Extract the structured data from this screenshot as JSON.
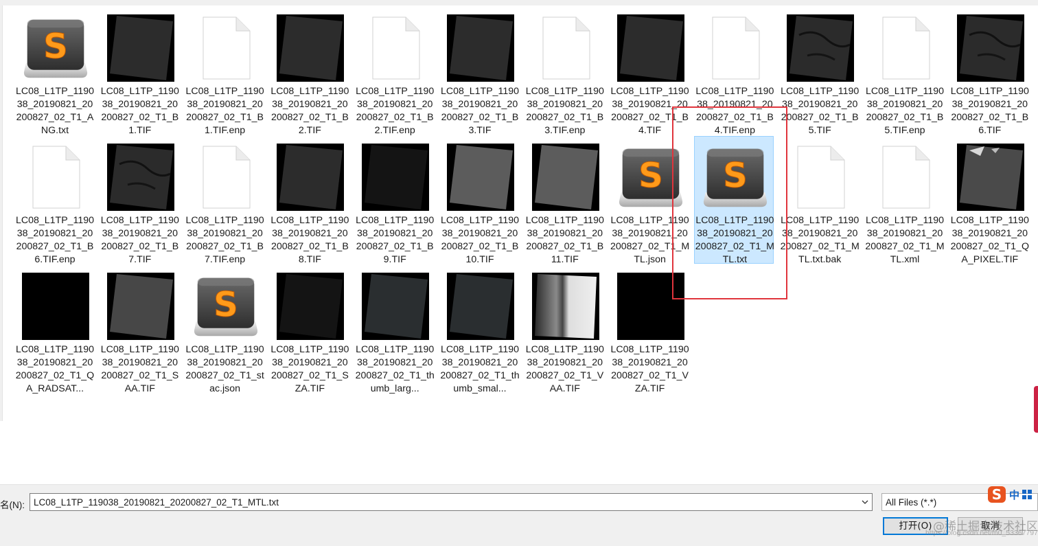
{
  "files": [
    {
      "label": "LC08_L1TP_119038_20190821_20200827_02_T1_ANG.txt",
      "icon": "sublime"
    },
    {
      "label": "LC08_L1TP_119038_20190821_20200827_02_T1_B1.TIF",
      "icon": "sat-dark"
    },
    {
      "label": "LC08_L1TP_119038_20190821_20200827_02_T1_B1.TIF.enp",
      "icon": "blank"
    },
    {
      "label": "LC08_L1TP_119038_20190821_20200827_02_T1_B2.TIF",
      "icon": "sat-dark"
    },
    {
      "label": "LC08_L1TP_119038_20190821_20200827_02_T1_B2.TIF.enp",
      "icon": "blank"
    },
    {
      "label": "LC08_L1TP_119038_20190821_20200827_02_T1_B3.TIF",
      "icon": "sat-dark"
    },
    {
      "label": "LC08_L1TP_119038_20190821_20200827_02_T1_B3.TIF.enp",
      "icon": "blank"
    },
    {
      "label": "LC08_L1TP_119038_20190821_20200827_02_T1_B4.TIF",
      "icon": "sat-dark"
    },
    {
      "label": "LC08_L1TP_119038_20190821_20200827_02_T1_B4.TIF.enp",
      "icon": "blank"
    },
    {
      "label": "LC08_L1TP_119038_20190821_20200827_02_T1_B5.TIF",
      "icon": "sat-river"
    },
    {
      "label": "LC08_L1TP_119038_20190821_20200827_02_T1_B5.TIF.enp",
      "icon": "blank"
    },
    {
      "label": "LC08_L1TP_119038_20190821_20200827_02_T1_B6.TIF",
      "icon": "sat-river"
    },
    {
      "label": "LC08_L1TP_119038_20190821_20200827_02_T1_B6.TIF.enp",
      "icon": "blank"
    },
    {
      "label": "LC08_L1TP_119038_20190821_20200827_02_T1_B7.TIF",
      "icon": "sat-river"
    },
    {
      "label": "LC08_L1TP_119038_20190821_20200827_02_T1_B7.TIF.enp",
      "icon": "blank"
    },
    {
      "label": "LC08_L1TP_119038_20190821_20200827_02_T1_B8.TIF",
      "icon": "sat-dark"
    },
    {
      "label": "LC08_L1TP_119038_20190821_20200827_02_T1_B9.TIF",
      "icon": "sat-black"
    },
    {
      "label": "LC08_L1TP_119038_20190821_20200827_02_T1_B10.TIF",
      "icon": "sat-gray"
    },
    {
      "label": "LC08_L1TP_119038_20190821_20200827_02_T1_B11.TIF",
      "icon": "sat-gray"
    },
    {
      "label": "LC08_L1TP_119038_20190821_20200827_02_T1_MTL.json",
      "icon": "sublime"
    },
    {
      "label": "LC08_L1TP_119038_20190821_20200827_02_T1_MTL.txt",
      "icon": "sublime",
      "selected": true
    },
    {
      "label": "LC08_L1TP_119038_20190821_20200827_02_T1_MTL.txt.bak",
      "icon": "blank"
    },
    {
      "label": "LC08_L1TP_119038_20190821_20200827_02_T1_MTL.xml",
      "icon": "blank"
    },
    {
      "label": "LC08_L1TP_119038_20190821_20200827_02_T1_QA_PIXEL.TIF",
      "icon": "sat-qa"
    },
    {
      "label": "LC08_L1TP_119038_20190821_20200827_02_T1_QA_RADSAT...",
      "icon": "black"
    },
    {
      "label": "LC08_L1TP_119038_20190821_20200827_02_T1_SAA.TIF",
      "icon": "sat-midgray"
    },
    {
      "label": "LC08_L1TP_119038_20190821_20200827_02_T1_stac.json",
      "icon": "sublime"
    },
    {
      "label": "LC08_L1TP_119038_20190821_20200827_02_T1_SZA.TIF",
      "icon": "sat-black"
    },
    {
      "label": "LC08_L1TP_119038_20190821_20200827_02_T1_thumb_larg...",
      "icon": "sat-thumb"
    },
    {
      "label": "LC08_L1TP_119038_20190821_20200827_02_T1_thumb_smal...",
      "icon": "sat-thumb"
    },
    {
      "label": "LC08_L1TP_119038_20190821_20200827_02_T1_VAA.TIF",
      "icon": "sat-stripe"
    },
    {
      "label": "LC08_L1TP_119038_20190821_20200827_02_T1_VZA.TIF",
      "icon": "black"
    }
  ],
  "bottom": {
    "name_label": "名(N):",
    "filename_value": "LC08_L1TP_119038_20190821_20200827_02_T1_MTL.txt",
    "filter_value": "All Files (*.*)",
    "open_button": "打开(O)",
    "cancel_button": "取消",
    "ime_lang": "中"
  },
  "watermark": {
    "text": "@稀土掘金技术社区",
    "url": "https://blog.csdn.net/m0_53367797"
  },
  "colors": {
    "selection_bg": "#cce8ff",
    "highlight_border": "#e0343c",
    "primary_button_border": "#0078d7"
  }
}
